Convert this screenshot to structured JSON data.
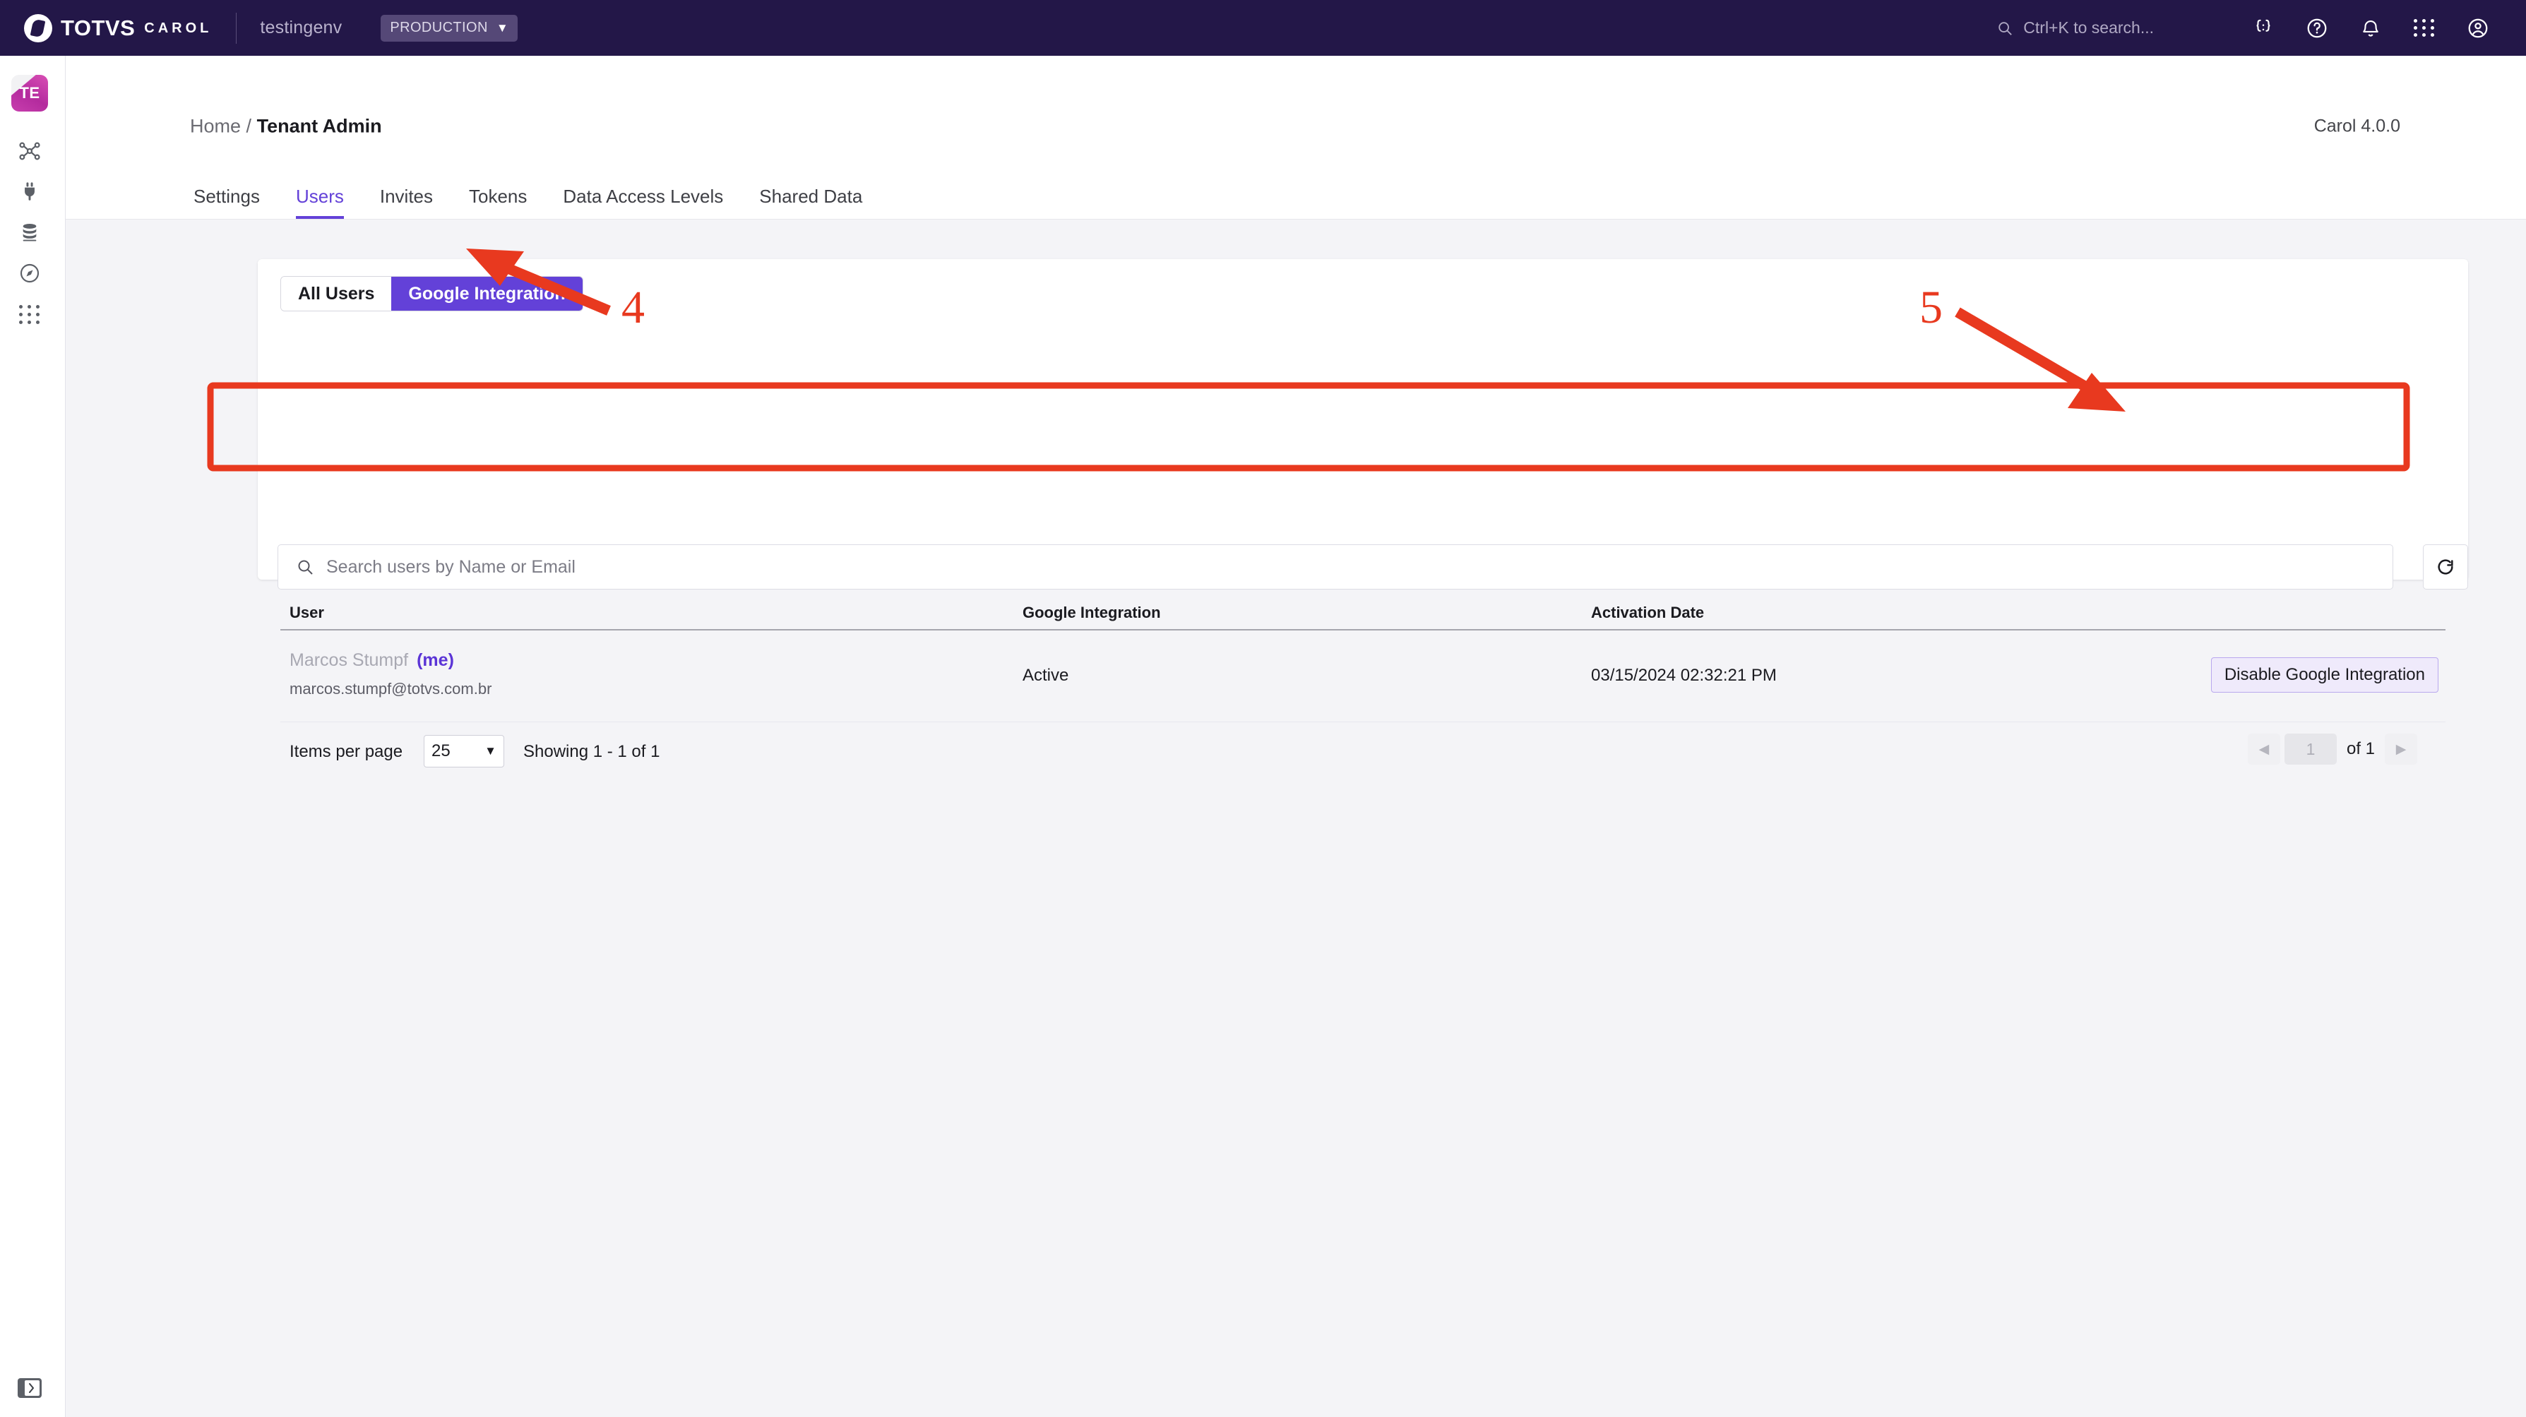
{
  "topbar": {
    "brand_primary": "TOTVS",
    "brand_secondary": "CAROL",
    "environment": "testingenv",
    "env_chip": "PRODUCTION",
    "env_caret": "▼",
    "search_placeholder": "Ctrl+K to search...",
    "icons": [
      {
        "name": "code-braces-icon",
        "glyph": "{:}"
      },
      {
        "name": "help-circle-icon",
        "glyph": "?"
      },
      {
        "name": "notification-bell-icon",
        "glyph": "🔔"
      },
      {
        "name": "apps-grid-icon",
        "glyph": "grid"
      },
      {
        "name": "user-account-icon",
        "glyph": "ⓘ"
      }
    ]
  },
  "rail": {
    "tenant_initials": "TE",
    "items": [
      {
        "name": "sidebar-item-pipelines",
        "icon": "network-graph-icon"
      },
      {
        "name": "sidebar-item-connectors",
        "icon": "plug-icon"
      },
      {
        "name": "sidebar-item-data",
        "icon": "database-stack-icon"
      },
      {
        "name": "sidebar-item-explore",
        "icon": "compass-icon"
      },
      {
        "name": "sidebar-item-apps",
        "icon": "apps-grid-icon"
      }
    ],
    "toggle_icon": "panel-expand-icon"
  },
  "header": {
    "breadcrumb_home": "Home",
    "breadcrumb_separator": "/",
    "breadcrumb_current": "Tenant Admin",
    "version": "Carol 4.0.0"
  },
  "tabs": [
    {
      "label": "Settings",
      "active": false
    },
    {
      "label": "Users",
      "active": true
    },
    {
      "label": "Invites",
      "active": false
    },
    {
      "label": "Tokens",
      "active": false
    },
    {
      "label": "Data Access Levels",
      "active": false
    },
    {
      "label": "Shared Data",
      "active": false
    }
  ],
  "segmented": {
    "all_users": "All Users",
    "google_integration": "Google Integration",
    "active": "Google Integration"
  },
  "search": {
    "placeholder": "Search users by Name or Email",
    "value": "",
    "refresh_icon": "refresh-icon"
  },
  "table": {
    "columns": [
      "User",
      "Google Integration",
      "Activation Date"
    ],
    "rows": [
      {
        "user_name": "Marcos Stumpf",
        "user_me_tag": "(me)",
        "user_email": "marcos.stumpf@totvs.com.br",
        "integration_status": "Active",
        "activation_date": "03/15/2024 02:32:21 PM",
        "action_label": "Disable Google Integration"
      }
    ]
  },
  "footer": {
    "items_per_page_label": "Items per page",
    "items_per_page_value": "25",
    "items_per_page_caret": "▼",
    "showing": "Showing 1 - 1 of 1",
    "prev_glyph": "◀",
    "next_glyph": "▶",
    "page_value": "1",
    "of_label": "of 1"
  },
  "annotations": {
    "color": "#e8391f",
    "step_4": "4",
    "step_5": "5"
  }
}
